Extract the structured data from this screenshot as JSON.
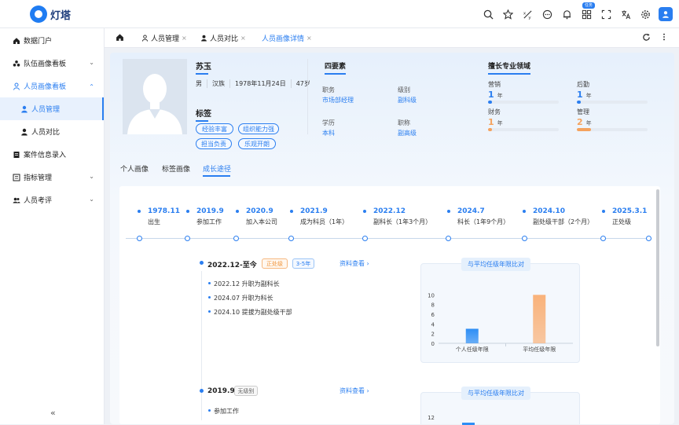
{
  "app": {
    "name": "灯塔",
    "badge": "任务"
  },
  "header_icons": [
    "search-icon",
    "star-icon",
    "formula-icon",
    "chat-icon",
    "bell-icon",
    "apps-icon",
    "fullscreen-icon",
    "translate-icon",
    "gear-icon",
    "user-avatar-icon"
  ],
  "sidebar": {
    "items": [
      {
        "label": "数据门户",
        "icon": "home-icon"
      },
      {
        "label": "队伍画像看板",
        "icon": "team-icon",
        "arrow": "⌄"
      },
      {
        "label": "人员画像看板",
        "icon": "person-icon",
        "arrow": "⌃"
      },
      {
        "label": "人员管理",
        "icon": "person-icon"
      },
      {
        "label": "人员对比",
        "icon": "person-icon"
      },
      {
        "label": "案件信息录入",
        "icon": "doc-icon"
      },
      {
        "label": "指标管理",
        "icon": "list-icon",
        "arrow": "⌄"
      },
      {
        "label": "人员考评",
        "icon": "group-icon",
        "arrow": "⌄"
      }
    ],
    "collapse": "«"
  },
  "tabs": [
    {
      "label": "人员管理",
      "close": "×"
    },
    {
      "label": "人员对比",
      "close": "×"
    },
    {
      "label": "人员画像详情",
      "close": "×"
    }
  ],
  "profile": {
    "name": "苏玉",
    "gender": "男",
    "ethnicity": "汉族",
    "birth": "1978年11月24日",
    "age": "47岁",
    "tags_title": "标签",
    "tags": [
      "经验丰富",
      "组织能力强",
      "担当负责",
      "乐观开朗"
    ]
  },
  "four_elements": {
    "title": "四要素",
    "items": [
      {
        "label": "职务",
        "value": "市场部经理"
      },
      {
        "label": "级别",
        "value": "副科级"
      },
      {
        "label": "学历",
        "value": "本科"
      },
      {
        "label": "职称",
        "value": "副高级"
      }
    ]
  },
  "expertise": {
    "title": "擅长专业领域",
    "items": [
      {
        "label": "营销",
        "value": "1",
        "unit": "年",
        "level": 0.05,
        "color": "#2a7ef0"
      },
      {
        "label": "后勤",
        "value": "1",
        "unit": "年",
        "level": 0.05,
        "color": "#2a7ef0"
      },
      {
        "label": "财务",
        "value": "1",
        "unit": "年",
        "level": 0.05,
        "color": "#f5a25d"
      },
      {
        "label": "管理",
        "value": "2",
        "unit": "年",
        "level": 0.2,
        "color": "#f5a25d"
      }
    ]
  },
  "subtabs": [
    "个人画像",
    "标签画像",
    "成长途径"
  ],
  "timeline": [
    {
      "date": "1978.11",
      "label": "出生"
    },
    {
      "date": "2019.9",
      "label": "参加工作"
    },
    {
      "date": "2020.9",
      "label": "加入本公司"
    },
    {
      "date": "2021.9",
      "label": "成为科员（1年）"
    },
    {
      "date": "2022.12",
      "label": "副科长（1年3个月）"
    },
    {
      "date": "2024.7",
      "label": "科长（1年9个月）"
    },
    {
      "date": "2024.10",
      "label": "副处级干部（2个月）"
    },
    {
      "date": "2025.3.1",
      "label": "正处级"
    }
  ],
  "stages": [
    {
      "title": "2022.12-至今",
      "pills": [
        "正处级",
        "3-5年"
      ],
      "link": "资料查看 ›",
      "events": [
        "2022.12 升职为副科长",
        "2024.07 升职为科长",
        "2024.10 提拔为副处级干部"
      ]
    },
    {
      "title": "2019.9",
      "pills": [
        "无级别"
      ],
      "link": "资料查看 ›",
      "events": [
        "参加工作"
      ]
    }
  ],
  "chart_data": [
    {
      "type": "bar",
      "title": "与平均任级年限比对",
      "categories": [
        "个人任级年限",
        "平均任级年限"
      ],
      "values": [
        3,
        10
      ],
      "colors": [
        "#2e8ef5",
        "#f9b27a"
      ],
      "yticks": [
        "0",
        "2",
        "4",
        "6",
        "8",
        "10"
      ],
      "ylim": [
        0,
        12
      ]
    },
    {
      "type": "bar",
      "title": "与平均任级年限比对",
      "yticks": [
        "12"
      ]
    }
  ]
}
